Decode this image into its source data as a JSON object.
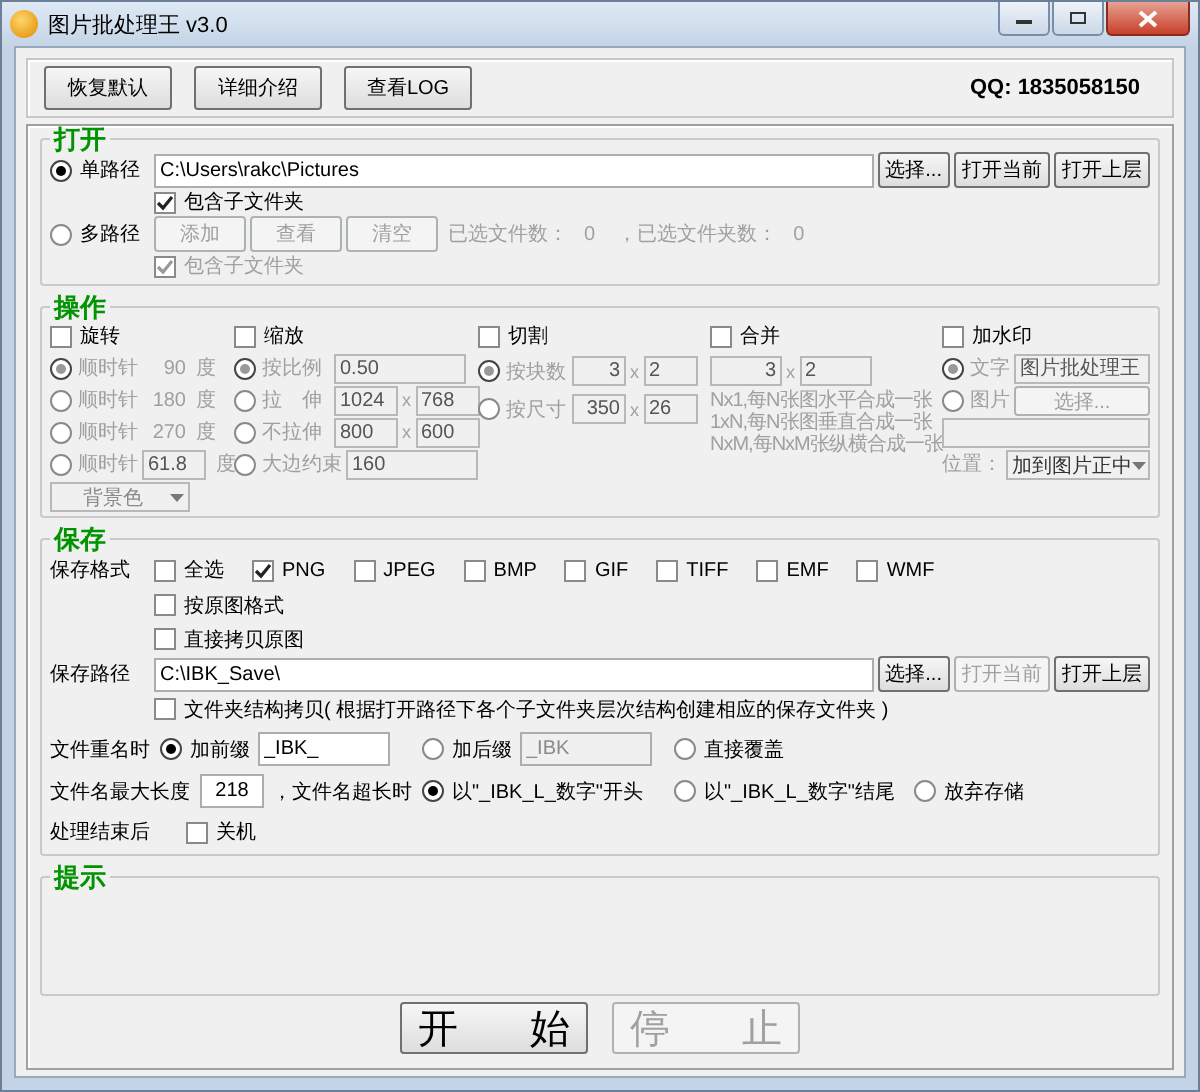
{
  "window": {
    "title": "图片批处理王 v3.0"
  },
  "toolbar": {
    "buttons": [
      "恢复默认",
      "详细介绍",
      "查看LOG"
    ],
    "qq": "QQ: 1835058150"
  },
  "open": {
    "title": "打开",
    "single": {
      "label": "单路径",
      "selected": true,
      "path": "C:\\Users\\rakc\\Pictures",
      "buttons": [
        {
          "label": "选择...",
          "disabled": false
        },
        {
          "label": "打开当前",
          "disabled": false
        },
        {
          "label": "打开上层",
          "disabled": false
        }
      ],
      "include": {
        "label": "包含子文件夹",
        "checked": true
      }
    },
    "multi": {
      "label": "多路径",
      "selected": false,
      "buttons": [
        "添加",
        "查看",
        "清空"
      ],
      "file_count_label": "已选文件数：",
      "file_count": "0",
      "folder_count_label": "，已选文件夹数：",
      "folder_count": "0",
      "include": {
        "label": "包含子文件夹",
        "checked": true
      }
    }
  },
  "operations": {
    "title": "操作",
    "rotate": {
      "label": "旋转",
      "checked": false,
      "options": [
        {
          "label": "顺时针",
          "value": "90",
          "unit": "度",
          "selected": true
        },
        {
          "label": "顺时针",
          "value": "180",
          "unit": "度",
          "selected": false
        },
        {
          "label": "顺时针",
          "value": "270",
          "unit": "度",
          "selected": false
        },
        {
          "label": "顺时针",
          "field": "61.8",
          "unit": "度",
          "selected": false
        }
      ],
      "background": "背景色"
    },
    "scale": {
      "label": "缩放",
      "checked": false,
      "options": [
        {
          "label": "按比例",
          "fields": [
            "0.50"
          ],
          "selected": true
        },
        {
          "label": "拉　伸",
          "fields": [
            "1024",
            "768"
          ],
          "sep": "x",
          "selected": false
        },
        {
          "label": "不拉伸",
          "fields": [
            "800",
            "600"
          ],
          "sep": "x",
          "selected": false
        },
        {
          "label": "大边约束",
          "fields": [
            "160"
          ],
          "selected": false
        }
      ]
    },
    "crop": {
      "label": "切割",
      "checked": false,
      "options": [
        {
          "label": "按块数",
          "fields": [
            "3",
            "2"
          ],
          "sep": "x",
          "selected": true
        },
        {
          "label": "按尺寸",
          "fields": [
            "350",
            "26"
          ],
          "sep": "x",
          "selected": false
        }
      ]
    },
    "merge": {
      "label": "合并",
      "checked": false,
      "fields": [
        "3",
        "2"
      ],
      "sep": "x",
      "notes": [
        "Nx1,每N张图水平合成一张",
        "1xN,每N张图垂直合成一张",
        "NxM,每NxM张纵横合成一张"
      ]
    },
    "watermark": {
      "label": "加水印",
      "checked": false,
      "text_option": {
        "label": "文字",
        "field": "图片批处理王",
        "selected": true
      },
      "image_option": {
        "label": "图片",
        "button": "选择...",
        "selected": false
      },
      "position_label": "位置：",
      "position": "加到图片正中"
    }
  },
  "save": {
    "title": "保存",
    "format_label": "保存格式",
    "formats": [
      {
        "label": "全选",
        "checked": false
      },
      {
        "label": "PNG",
        "checked": true
      },
      {
        "label": "JPEG",
        "checked": false
      },
      {
        "label": "BMP",
        "checked": false
      },
      {
        "label": "GIF",
        "checked": false
      },
      {
        "label": "TIFF",
        "checked": false
      },
      {
        "label": "EMF",
        "checked": false
      },
      {
        "label": "WMF",
        "checked": false
      }
    ],
    "extra": [
      {
        "label": "按原图格式",
        "checked": false
      },
      {
        "label": "直接拷贝原图",
        "checked": false
      }
    ],
    "path_label": "保存路径",
    "path": "C:\\IBK_Save\\",
    "buttons": [
      {
        "label": "选择...",
        "disabled": false
      },
      {
        "label": "打开当前",
        "disabled": true
      },
      {
        "label": "打开上层",
        "disabled": false
      }
    ],
    "structure": {
      "label": "文件夹结构拷贝( 根据打开路径下各个子文件夹层次结构创建相应的保存文件夹 )",
      "checked": false
    },
    "rename_label": "文件重名时",
    "rename": [
      {
        "label": "加前缀",
        "field": "_IBK_",
        "selected": true
      },
      {
        "label": "加后缀",
        "field": "_IBK",
        "selected": false
      },
      {
        "label": "直接覆盖",
        "selected": false
      }
    ],
    "maxlen_label": "文件名最大长度",
    "maxlen": "218",
    "overlong_label": "，文件名超长时",
    "overlong": [
      {
        "label": "以\"_IBK_L_数字\"开头",
        "selected": true
      },
      {
        "label": "以\"_IBK_L_数字\"结尾",
        "selected": false
      },
      {
        "label": "放弃存储",
        "selected": false
      }
    ],
    "after_label": "处理结束后",
    "shutdown": {
      "label": "关机",
      "checked": false
    }
  },
  "tips": {
    "title": "提示"
  },
  "actions": [
    {
      "label": "开 始",
      "disabled": false
    },
    {
      "label": "停 止",
      "disabled": true
    }
  ]
}
